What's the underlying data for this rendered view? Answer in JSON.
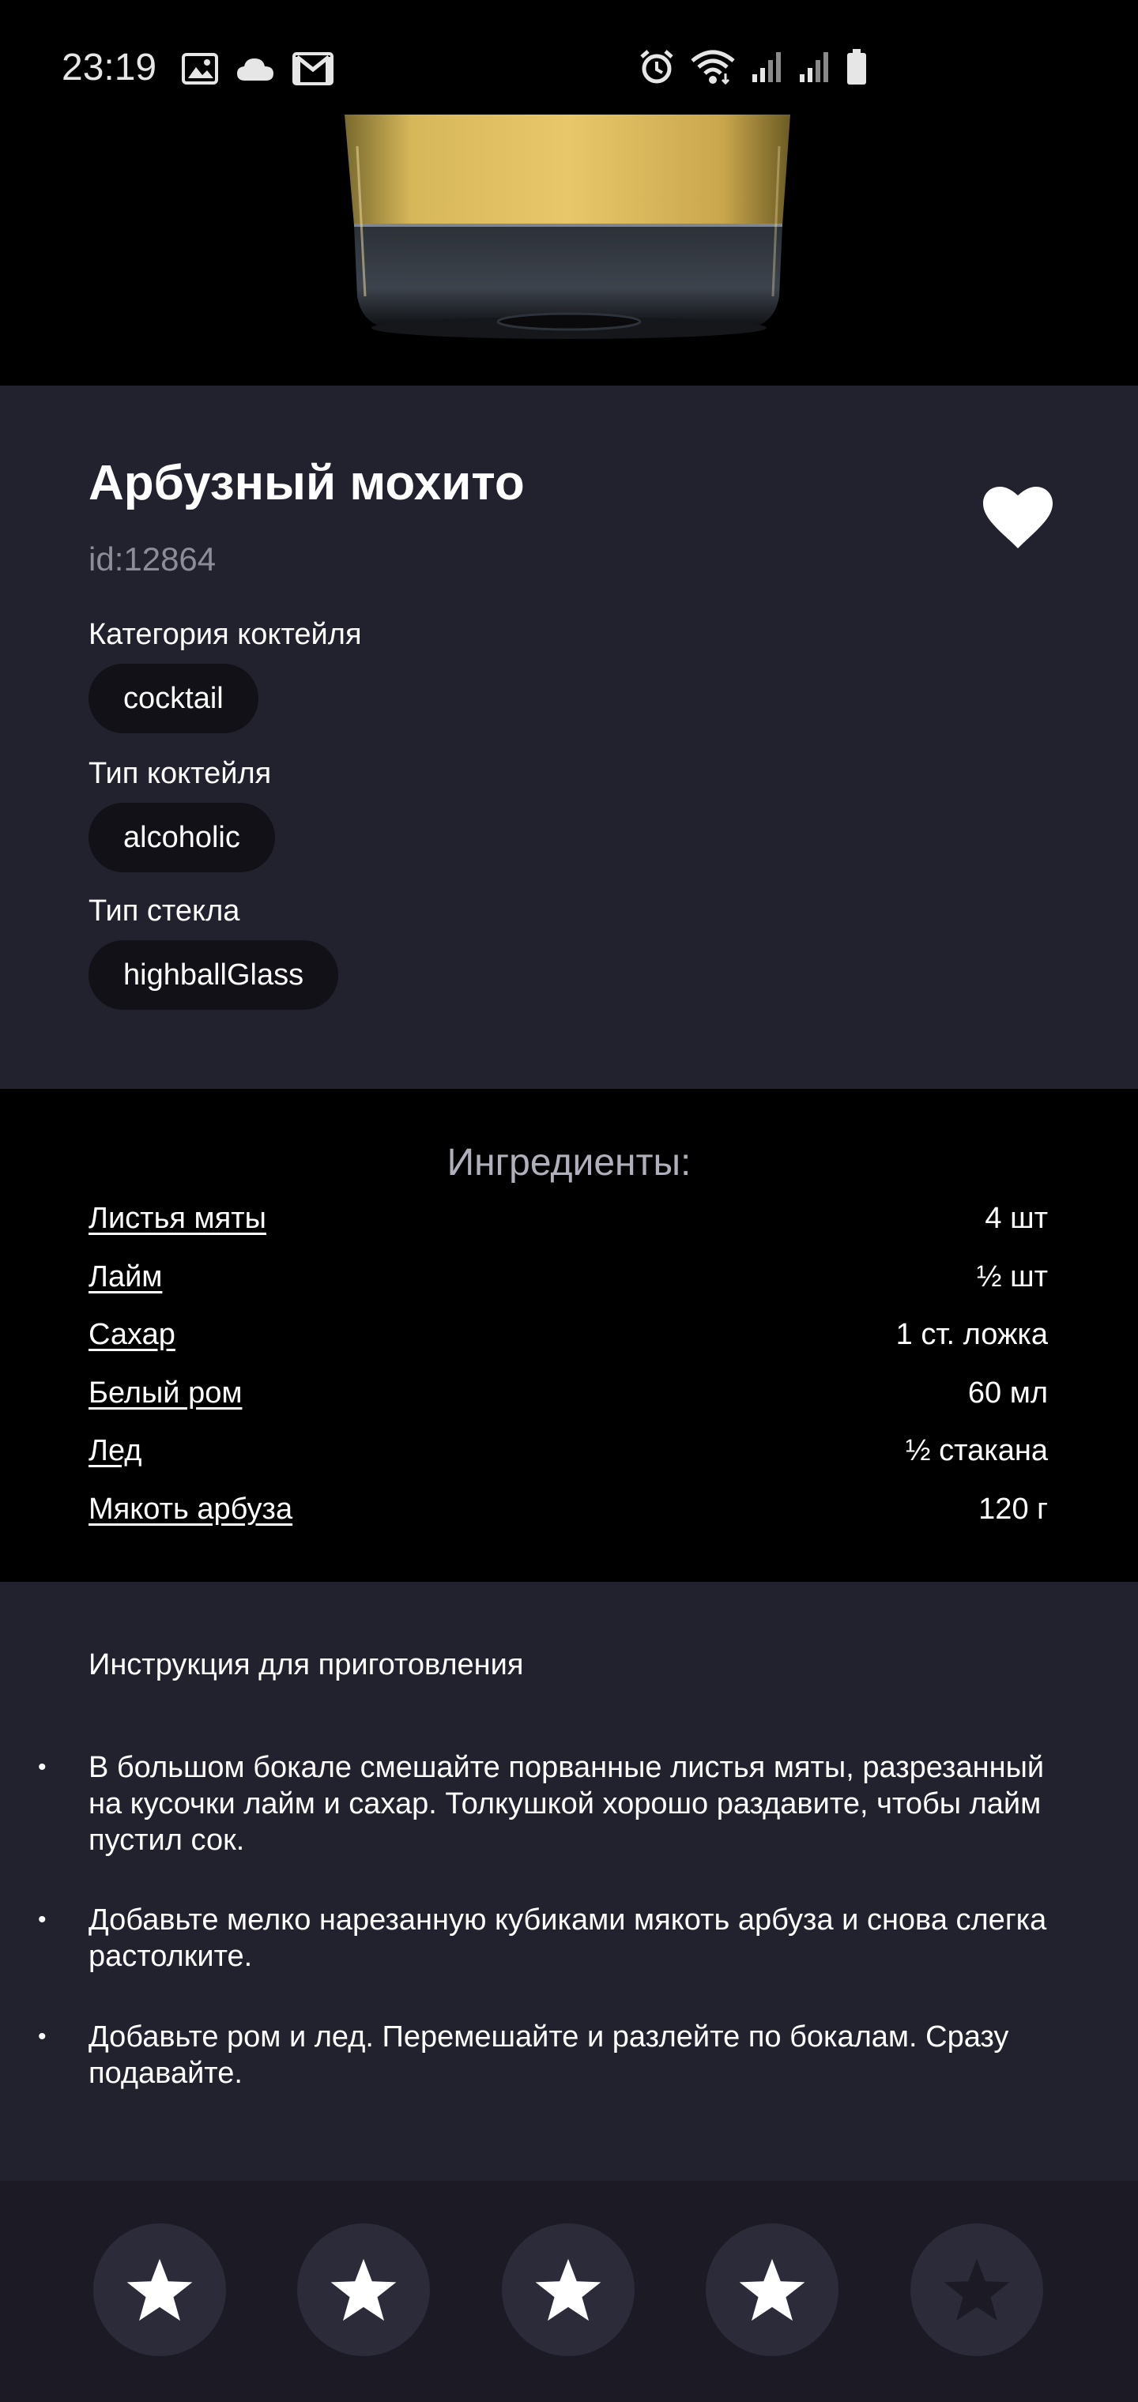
{
  "status_bar": {
    "time": "23:19",
    "left_icons": [
      "image-icon",
      "cloud-icon",
      "gmail-icon"
    ],
    "right_icons": [
      "alarm-icon",
      "wifi-icon",
      "signal-icon",
      "signal-icon",
      "battery-icon"
    ]
  },
  "drink": {
    "name": "Арбузный мохито",
    "id": "id:12864",
    "favorite_icon": "heart-icon",
    "category_label": "Категория коктейля",
    "category": "cocktail",
    "type_label": "Тип коктейля",
    "type": "alcoholic",
    "glass_label": "Тип стекла",
    "glass": "highballGlass"
  },
  "ingredients": {
    "title": "Ингредиенты:",
    "items": [
      {
        "name": "Листья мяты",
        "measure": "4 шт"
      },
      {
        "name": "Лайм",
        "measure": "½ шт"
      },
      {
        "name": "Сахар",
        "measure": "1 ст. ложка"
      },
      {
        "name": "Белый ром",
        "measure": "60 мл"
      },
      {
        "name": "Лед",
        "measure": "½ стакана"
      },
      {
        "name": "Мякоть арбуза",
        "measure": "120 г"
      }
    ]
  },
  "instructions": {
    "title": "Инструкция для приготовления",
    "steps": [
      "В большом бокале смешайте порванные листья мяты, разрезанный на кусочки лайм и сахар. Толкушкой хорошо раздавите, чтобы лайм пустил сок.",
      "Добавьте мелко нарезанную кубиками мякоть арбуза и снова слегка растолките.",
      "Добавьте ром и лед. Перемешайте и разлейте по бокалам. Сразу подавайте."
    ]
  },
  "rating": {
    "value": 4,
    "max": 5
  },
  "colors": {
    "card_background": "#22212e",
    "ingredients_background": "#000000",
    "chip_background": "#111117",
    "muted_text": "#8d8c99",
    "star_filled": "#ffffff",
    "star_empty": "#1b1a25"
  }
}
